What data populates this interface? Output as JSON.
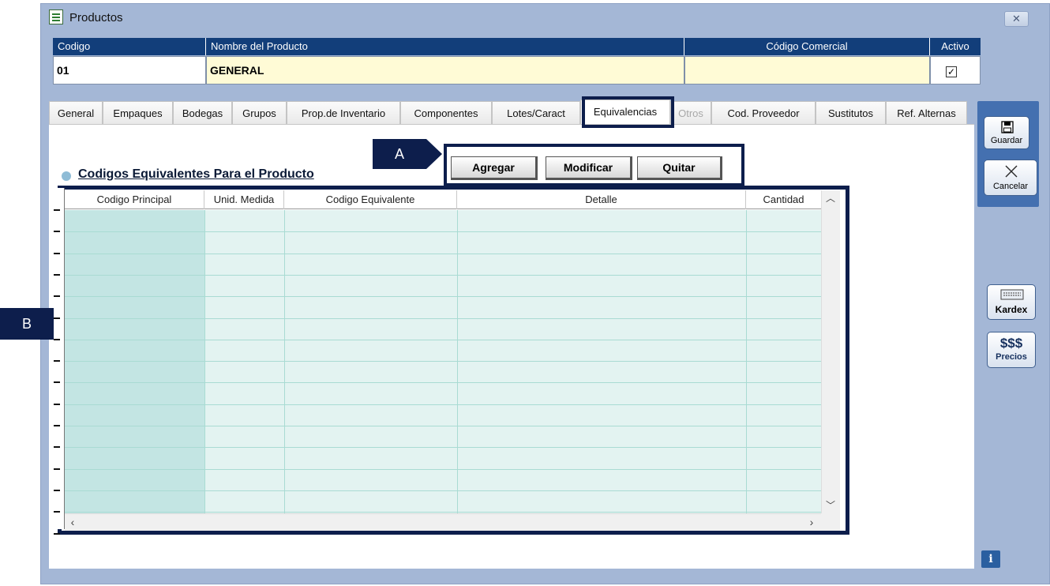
{
  "window": {
    "title": "Productos",
    "close_symbol": "✕"
  },
  "header": {
    "codigo_label": "Codigo",
    "nombre_label": "Nombre del Producto",
    "comercial_label": "Código Comercial",
    "activo_label": "Activo",
    "codigo_value": "01",
    "nombre_value": "GENERAL",
    "comercial_value": "",
    "activo_checked": "☑"
  },
  "tabs": [
    "General",
    "Empaques",
    "Bodegas",
    "Grupos",
    "Prop.de Inventario",
    "Componentes",
    "Lotes/Caract",
    "Equivalencias",
    "Otros",
    "Cod. Proveedor",
    "Sustitutos",
    "Ref. Alternas"
  ],
  "active_tab": "Equivalencias",
  "disabled_tabs": [
    "Otros"
  ],
  "section_title": "Codigos Equivalentes Para el Producto",
  "actions": {
    "agregar": "Agregar",
    "modificar": "Modificar",
    "quitar": "Quitar"
  },
  "callouts": {
    "a": "A",
    "b": "B"
  },
  "grid": {
    "columns": [
      "Codigo Principal",
      "Unid. Medida",
      "Codigo Equivalente",
      "Detalle",
      "Cantidad"
    ],
    "rows": []
  },
  "sidebar": {
    "guardar": "Guardar",
    "cancelar": "Cancelar",
    "kardex": "Kardex",
    "precios_symbol": "$$$",
    "precios": "Precios",
    "info": "i"
  },
  "colors": {
    "header_blue": "#123e7a",
    "callout_navy": "#0d1e4c",
    "grid_fill": "#e3f3f1",
    "panel_blue": "#4470b0"
  }
}
